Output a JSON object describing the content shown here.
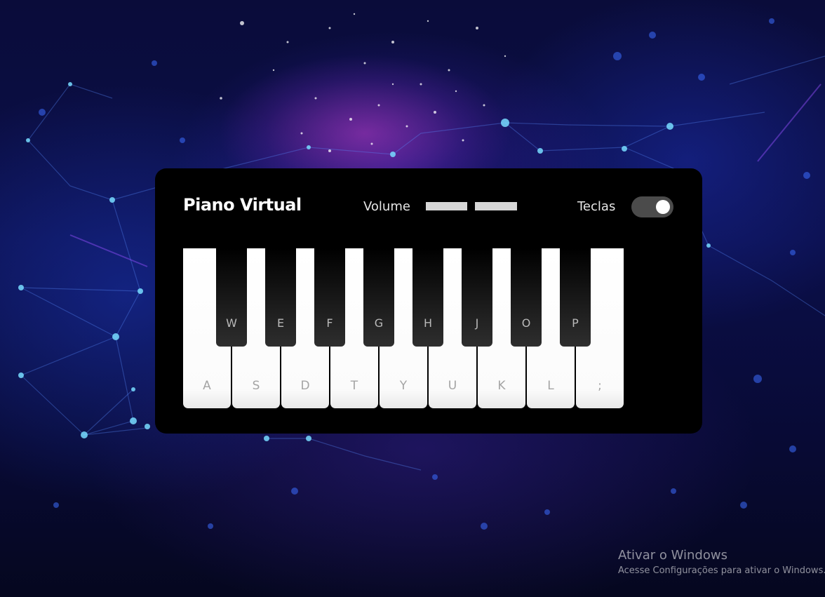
{
  "app": {
    "title": "Piano Virtual"
  },
  "header": {
    "volume_label": "Volume",
    "volume_level": 0.5,
    "keys_label": "Teclas",
    "keys_toggle_on": true
  },
  "piano": {
    "white_keys": [
      {
        "label": "A"
      },
      {
        "label": "S"
      },
      {
        "label": "D"
      },
      {
        "label": "T"
      },
      {
        "label": "Y"
      },
      {
        "label": "U"
      },
      {
        "label": "K"
      },
      {
        "label": "L"
      },
      {
        "label": ";"
      }
    ],
    "black_keys": [
      {
        "label": "W"
      },
      {
        "label": "E"
      },
      {
        "label": "F"
      },
      {
        "label": "G"
      },
      {
        "label": "H"
      },
      {
        "label": "J"
      },
      {
        "label": "O"
      },
      {
        "label": "P"
      }
    ]
  },
  "watermark": {
    "title": "Ativar o Windows",
    "subtitle": "Acesse Configurações para ativar o Windows."
  },
  "colors": {
    "panel": "#000000",
    "white_key": "#ffffff",
    "black_key": "#000000",
    "toggle_track": "#4b4b4b",
    "volume_track": "#d7d7d7"
  }
}
